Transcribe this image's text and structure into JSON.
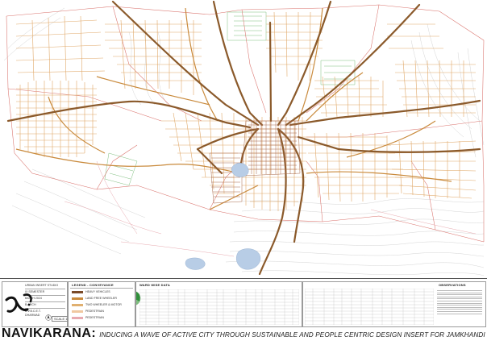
{
  "map": {
    "legend": {
      "title": "LEGEND - CONVEYANCE",
      "items": [
        {
          "label": "HEAVY VEHICLES",
          "color": "#7a4a28"
        },
        {
          "label": "LAND FREE WHEELER",
          "color": "#c98a3c"
        },
        {
          "label": "TWO WHEELER & MOTOR",
          "color": "#e0b070"
        },
        {
          "label": "PEDESTRIAN",
          "color": "#f0c8a0"
        },
        {
          "label": "PEDESTRIAN",
          "color": "#e8aab0"
        }
      ]
    },
    "colors": {
      "major_road": "#8b5a2b",
      "secondary_road": "#c98a3c",
      "minor_road": "#e0a868",
      "boundary": "#d9706a",
      "contour": "#c8c8c8",
      "water": "#b8cde6",
      "green": "#7fbf7f",
      "ink": "#111111"
    }
  },
  "title_block": {
    "studio": "URBAN INSERT STUDIO",
    "semester": "IX SEMESTER",
    "batch": "BATCH 2024",
    "program": "B.ARCH",
    "college": "B.V.B.C.E.T.",
    "city": "DHARWAD",
    "scale": "SCALE 1:4000",
    "ward_header": "WARD WISE DATA",
    "observations_header": "OBSERVATIONS"
  },
  "footer": {
    "brand": "NAVIKARANA:",
    "tagline": "INDUCING A WAVE OF ACTIVE CITY THROUGH SUSTAINABLE AND PEOPLE CENTRIC DESIGN INSERT FOR JAMKHANDI"
  }
}
